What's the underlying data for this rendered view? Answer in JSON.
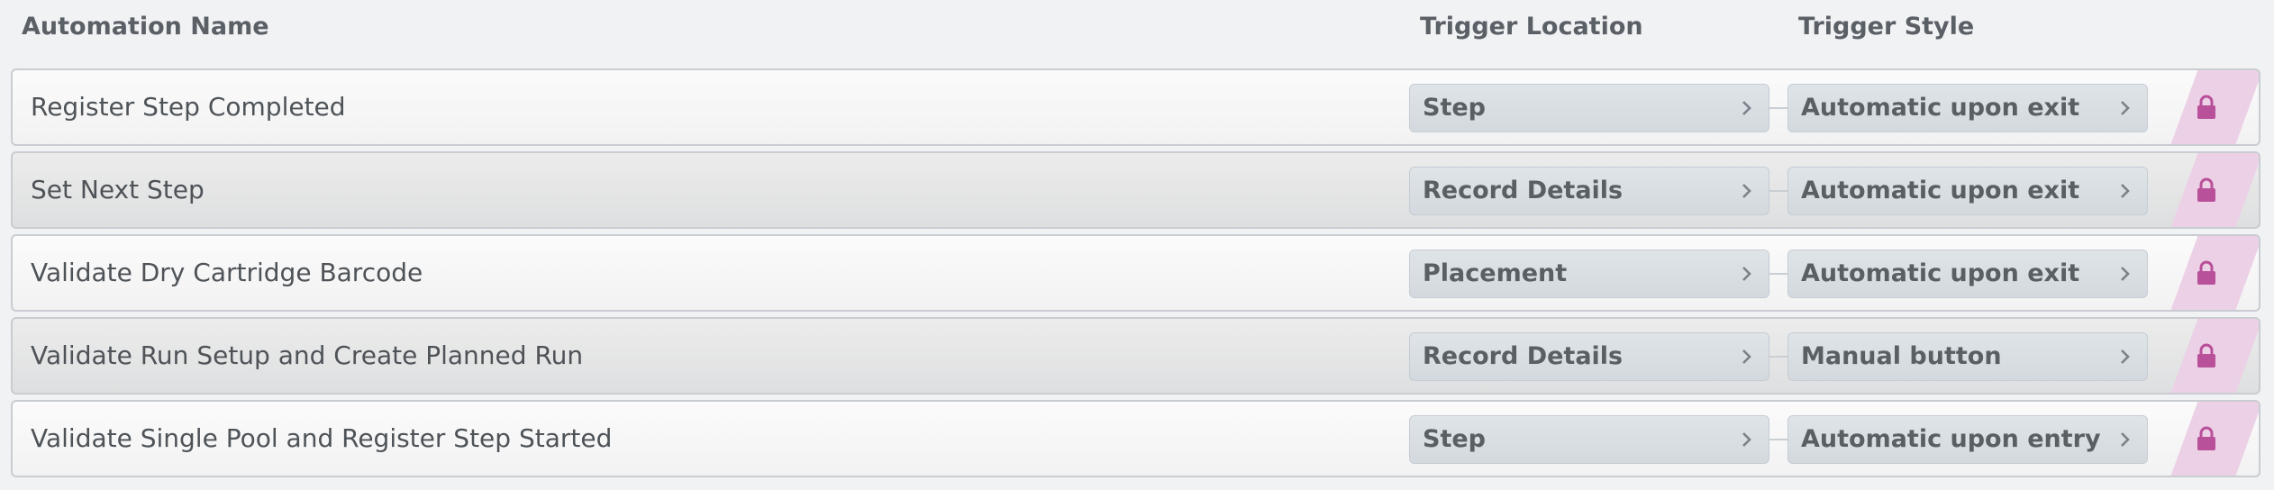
{
  "headers": {
    "name": "Automation Name",
    "location": "Trigger Location",
    "style": "Trigger Style"
  },
  "rows": [
    {
      "name": "Register Step Completed",
      "location": "Step",
      "style": "Automatic upon exit",
      "icon": "lock-icon"
    },
    {
      "name": "Set Next Step",
      "location": "Record Details",
      "style": "Automatic upon exit",
      "icon": "lock-icon"
    },
    {
      "name": "Validate Dry Cartridge Barcode",
      "location": "Placement",
      "style": "Automatic upon exit",
      "icon": "lock-icon"
    },
    {
      "name": "Validate Run Setup and Create Planned Run",
      "location": "Record Details",
      "style": "Manual button",
      "icon": "lock-icon"
    },
    {
      "name": "Validate Single Pool and Register Step Started",
      "location": "Step",
      "style": "Automatic upon entry",
      "icon": "lock-icon"
    }
  ],
  "colors": {
    "lock": "#b9509a",
    "lock_stripe": "#ecd1e6",
    "pill_bg": "#d8dde2"
  }
}
